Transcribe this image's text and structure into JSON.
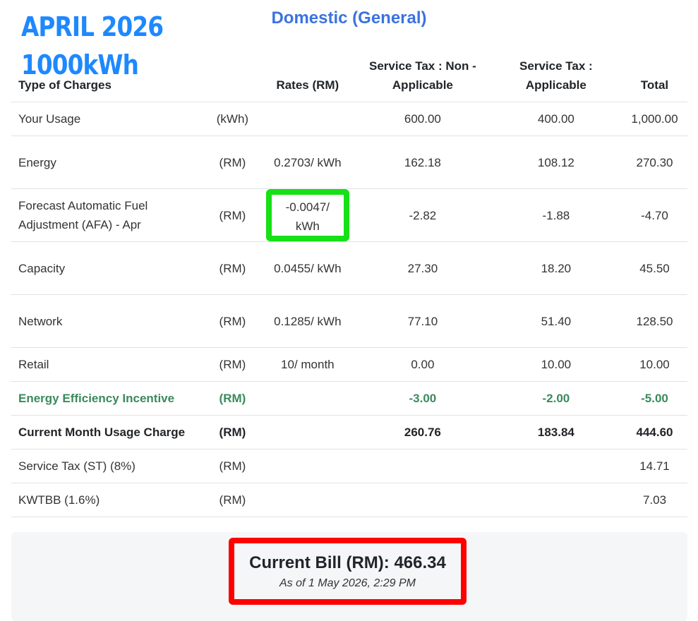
{
  "overlay": {
    "period": "APRIL 2026",
    "usage": "1000kWh"
  },
  "tariff_title": "Domestic (General)",
  "headers": {
    "type": "Type of Charges",
    "rates": "Rates (RM)",
    "non_applicable": "Service Tax : Non - Applicable",
    "applicable": "Service Tax : Applicable",
    "total": "Total"
  },
  "rows": [
    {
      "label": "Your Usage",
      "unit": "(kWh)",
      "rate": "",
      "non_applicable": "600.00",
      "applicable": "400.00",
      "total": "1,000.00"
    },
    {
      "label": "Energy",
      "unit": "(RM)",
      "rate": "0.2703/ kWh",
      "non_applicable": "162.18",
      "applicable": "108.12",
      "total": "270.30"
    },
    {
      "label": "Forecast Automatic Fuel Adjustment (AFA) - Apr",
      "unit": "(RM)",
      "rate": "-0.0047/ kWh",
      "non_applicable": "-2.82",
      "applicable": "-1.88",
      "total": "-4.70"
    },
    {
      "label": "Capacity",
      "unit": "(RM)",
      "rate": "0.0455/ kWh",
      "non_applicable": "27.30",
      "applicable": "18.20",
      "total": "45.50"
    },
    {
      "label": "Network",
      "unit": "(RM)",
      "rate": "0.1285/ kWh",
      "non_applicable": "77.10",
      "applicable": "51.40",
      "total": "128.50"
    },
    {
      "label": "Retail",
      "unit": "(RM)",
      "rate": "10/ month",
      "non_applicable": "0.00",
      "applicable": "10.00",
      "total": "10.00"
    },
    {
      "label": "Energy Efficiency Incentive",
      "unit": "(RM)",
      "rate": "",
      "non_applicable": "-3.00",
      "applicable": "-2.00",
      "total": "-5.00"
    },
    {
      "label": "Current Month Usage Charge",
      "unit": "(RM)",
      "rate": "",
      "non_applicable": "260.76",
      "applicable": "183.84",
      "total": "444.60"
    },
    {
      "label": "Service Tax (ST) (8%)",
      "unit": "(RM)",
      "rate": "",
      "non_applicable": "",
      "applicable": "",
      "total": "14.71"
    },
    {
      "label": "KWTBB (1.6%)",
      "unit": "(RM)",
      "rate": "",
      "non_applicable": "",
      "applicable": "",
      "total": "7.03"
    }
  ],
  "bill": {
    "total": "Current Bill (RM): 466.34",
    "as_of": "As of 1 May 2026, 2:29 PM"
  },
  "colors": {
    "title_blue": "#3b73e0",
    "overlay_blue": "#1e88ff",
    "incentive_green": "#3a8a5c",
    "highlight_green": "#16e016",
    "highlight_red": "#ff0000"
  }
}
